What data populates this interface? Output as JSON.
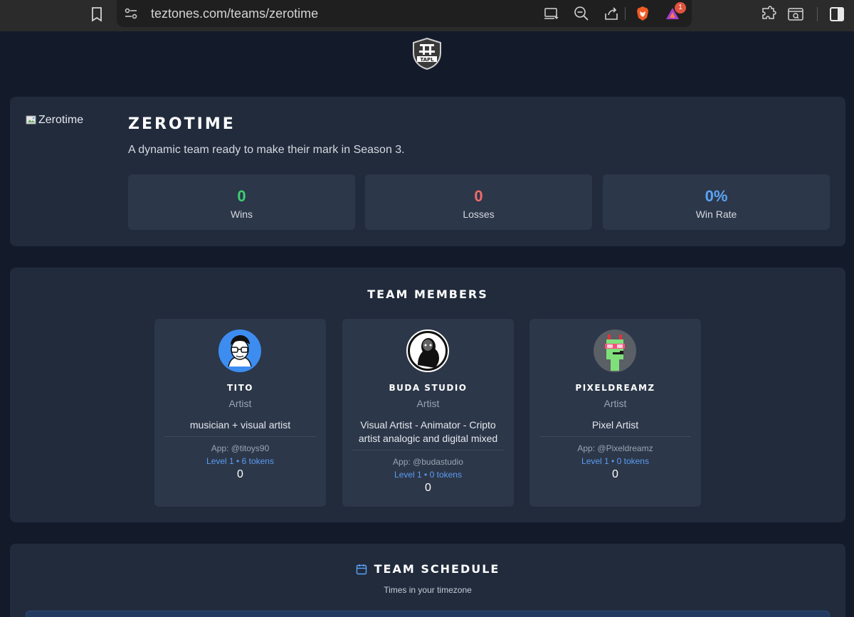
{
  "browser": {
    "url": "teztones.com/teams/zerotime",
    "notification_count": "1"
  },
  "logo": {
    "alt": "TAPL league logo"
  },
  "team": {
    "image_alt": "Zerotime",
    "name": "ZEROTIME",
    "description": "A dynamic team ready to make their mark in Season 3.",
    "stats": [
      {
        "value": "0",
        "label": "Wins",
        "color": "#3ecf72"
      },
      {
        "value": "0",
        "label": "Losses",
        "color": "#f26a6a"
      },
      {
        "value": "0%",
        "label": "Win Rate",
        "color": "#5aa4f7"
      }
    ]
  },
  "members_section": {
    "title": "TEAM MEMBERS",
    "members": [
      {
        "name": "TITO",
        "role": "Artist",
        "bio": "musician + visual artist",
        "app": "App: @titoys90",
        "level": "Level 1 • 6 tokens",
        "count": "0"
      },
      {
        "name": "BUDA STUDIO",
        "role": "Artist",
        "bio": "Visual Artist - Animator - Cripto artist analogic and digital mixed",
        "app": "App: @budastudio",
        "level": "Level 1 • 0 tokens",
        "count": "0"
      },
      {
        "name": "PIXELDREAMZ",
        "role": "Artist",
        "bio": "Pixel Artist",
        "app": "App: @Pixeldreamz",
        "level": "Level 1 • 0 tokens",
        "count": "0"
      }
    ]
  },
  "schedule": {
    "title": "TEAM SCHEDULE",
    "subtitle": "Times in your timezone"
  },
  "colors": {
    "background": "#131b2b",
    "card": "#212b3c",
    "inner_card": "#2c3749",
    "link": "#5b9cf2"
  }
}
